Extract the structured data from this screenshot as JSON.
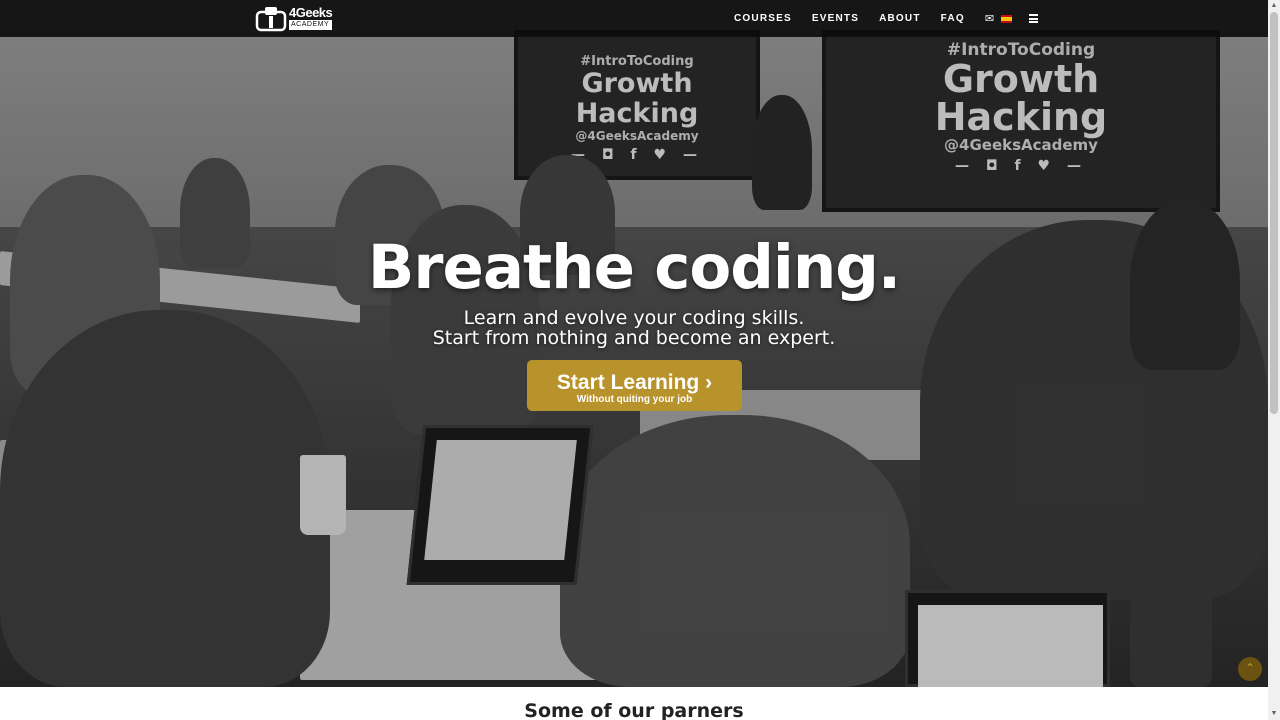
{
  "navbar": {
    "logo_top": "4Geeks",
    "logo_bottom": "ACADEMY",
    "links": [
      "COURSES",
      "EVENTS",
      "ABOUT",
      "FAQ"
    ],
    "icons": [
      "envelope-icon",
      "spain-flag-icon",
      "hamburger-menu-icon"
    ]
  },
  "hero": {
    "screen_tag": "#IntroToCoding",
    "screen_title_1": "Growth",
    "screen_title_2": "Hacking",
    "screen_handle": "@4GeeksAcademy",
    "screen_social": "— ◘ f ♥ —",
    "title": "Breathe coding.",
    "subtitle_line1": "Learn and evolve your coding skills.",
    "subtitle_line2": "Start from nothing and become an expert.",
    "cta_label": "Start Learning ›",
    "cta_sub": "Without quiting your job"
  },
  "partners": {
    "heading": "Some of our parners"
  },
  "colors": {
    "accent": "#b8922a",
    "navbar": "#0c0c0c",
    "scroll_top": "#6b5210"
  }
}
